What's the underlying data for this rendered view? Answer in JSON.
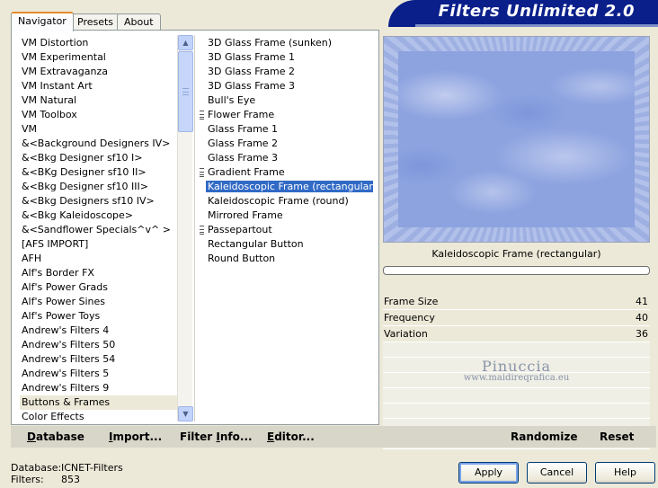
{
  "tabs": [
    "Navigator",
    "Presets",
    "About"
  ],
  "brand": "Filters Unlimited 2.0",
  "categories": [
    "VM Distortion",
    "VM Experimental",
    "VM Extravaganza",
    "VM Instant Art",
    "VM Natural",
    "VM Toolbox",
    "VM",
    "&<Background Designers IV>",
    "&<Bkg Designer sf10 I>",
    "&<BKg Designer sf10 II>",
    "&<Bkg Designer sf10 III>",
    "&<Bkg Designers sf10 IV>",
    "&<Bkg Kaleidoscope>",
    "&<Sandflower Specials^v^ >",
    "[AFS IMPORT]",
    "AFH",
    "Alf's Border FX",
    "Alf's Power Grads",
    "Alf's Power Sines",
    "Alf's Power Toys",
    "Andrew's Filters 4",
    "Andrew's Filters 50",
    "Andrew's Filters 54",
    "Andrew's Filters 5",
    "Andrew's Filters 9",
    "Buttons & Frames",
    "Color Effects"
  ],
  "selected_category": "Buttons & Frames",
  "filters": [
    {
      "label": "3D Glass Frame (sunken)",
      "grip": false
    },
    {
      "label": "3D Glass Frame 1",
      "grip": false
    },
    {
      "label": "3D Glass Frame 2",
      "grip": false
    },
    {
      "label": "3D Glass Frame 3",
      "grip": false
    },
    {
      "label": "Bull's Eye",
      "grip": false
    },
    {
      "label": "Flower Frame",
      "grip": true
    },
    {
      "label": "Glass Frame 1",
      "grip": false
    },
    {
      "label": "Glass Frame 2",
      "grip": false
    },
    {
      "label": "Glass Frame 3",
      "grip": false
    },
    {
      "label": "Gradient Frame",
      "grip": true
    },
    {
      "label": "Kaleidoscopic Frame (rectangular)",
      "grip": false
    },
    {
      "label": "Kaleidoscopic Frame (round)",
      "grip": false
    },
    {
      "label": "Mirrored Frame",
      "grip": false
    },
    {
      "label": "Passepartout",
      "grip": true
    },
    {
      "label": "Rectangular Button",
      "grip": false
    },
    {
      "label": "Round Button",
      "grip": false
    }
  ],
  "selected_filter": "Kaleidoscopic Frame (rectangular)",
  "preview": {
    "filter_name": "Kaleidoscopic Frame (rectangular)",
    "progress": 0
  },
  "params": [
    {
      "label": "Frame Size",
      "value": "41"
    },
    {
      "label": "Frequency",
      "value": "40"
    },
    {
      "label": "Variation",
      "value": "36"
    }
  ],
  "watermark": {
    "name": "Pinuccia",
    "url": "www.maidireqrafica.eu"
  },
  "toolbar": {
    "database": {
      "u": "D",
      "rest": "atabase"
    },
    "import": {
      "u": "I",
      "rest": "mport..."
    },
    "filter_info_pre": "Filter ",
    "filter_info": {
      "u": "I",
      "rest": "nfo..."
    },
    "editor": {
      "u": "E",
      "rest": "ditor..."
    },
    "randomize": "Randomize",
    "reset": "Reset"
  },
  "status": {
    "database_label": "Database:",
    "database_value": "ICNET-Filters",
    "filters_label": "Filters:",
    "filters_value": "853"
  },
  "buttons": {
    "apply": "Apply",
    "cancel": "Cancel",
    "help": "Help"
  }
}
